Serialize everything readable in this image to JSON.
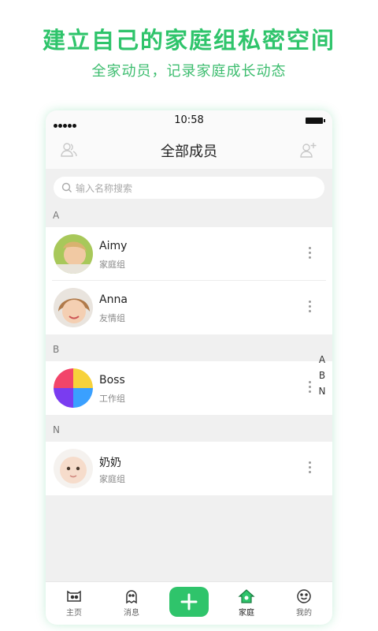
{
  "promo": {
    "headline": "建立自己的家庭组私密空间",
    "subline": "全家动员，记录家庭成长动态"
  },
  "status": {
    "time": "10:58"
  },
  "nav": {
    "title": "全部成员",
    "left_icon": "group-members-icon",
    "right_icon": "add-member-icon"
  },
  "search": {
    "placeholder": "输入名称搜索"
  },
  "sections": [
    {
      "letter": "A",
      "members": [
        {
          "name": "Aimy",
          "group": "家庭组"
        },
        {
          "name": "Anna",
          "group": "友情组"
        }
      ]
    },
    {
      "letter": "B",
      "members": [
        {
          "name": "Boss",
          "group": "工作组"
        }
      ]
    },
    {
      "letter": "N",
      "members": [
        {
          "name": "奶奶",
          "group": "家庭组"
        }
      ]
    }
  ],
  "index_letters": [
    "A",
    "B",
    "N"
  ],
  "tabs": [
    {
      "label": "主页",
      "icon": "home-face-icon"
    },
    {
      "label": "消息",
      "icon": "message-ghost-icon"
    },
    {
      "label": "",
      "icon": "plus-icon"
    },
    {
      "label": "家庭",
      "icon": "family-house-icon",
      "active": true
    },
    {
      "label": "我的",
      "icon": "smiley-icon"
    }
  ],
  "colors": {
    "brand_green": "#2fc46b"
  }
}
